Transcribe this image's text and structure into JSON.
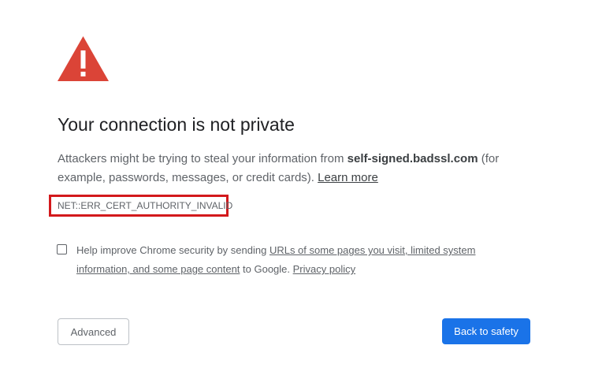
{
  "warning": {
    "icon": "warning-triangle-icon",
    "color": "#db4437"
  },
  "heading": {
    "title": "Your connection is not private"
  },
  "main_message": {
    "text_before": "Attackers might be trying to steal your information from ",
    "hostname": "self-signed.badssl.com",
    "text_after": " (for example, passwords, messages, or credit cards). ",
    "learn_more": "Learn more"
  },
  "error": {
    "code": "NET::ERR_CERT_AUTHORITY_INVALID",
    "highlight_color": "#d3191c"
  },
  "extended_reporting": {
    "checked": false,
    "text_before": "Help improve Chrome security by sending ",
    "link_text": "URLs of some pages you visit, limited system information, and some page content",
    "text_middle": " to Google. ",
    "privacy_link": "Privacy policy"
  },
  "buttons": {
    "advanced": "Advanced",
    "back_to_safety": "Back to safety",
    "primary_color": "#1a73e8"
  }
}
